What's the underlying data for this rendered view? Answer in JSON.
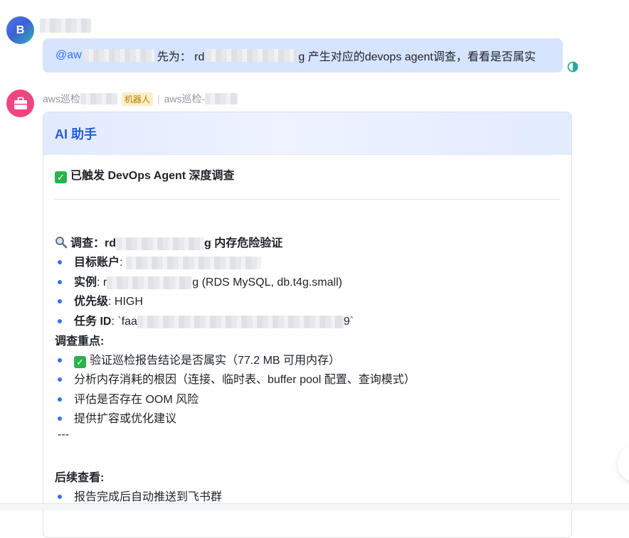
{
  "user": {
    "avatar_letter": "B",
    "message_mention": "@aw",
    "message_middle": "先为： rd",
    "message_tail": "g 产生对应的devops agent调查，看看是否属实"
  },
  "bot": {
    "name_prefix": "aws巡检",
    "badge": "机器人",
    "separator": "|",
    "group_prefix": "aws巡检-",
    "card": {
      "title": "AI 助手",
      "triggered": "已触发 DevOps Agent 深度调查",
      "investigation_label": "调查：",
      "investigation_prefix": "rd",
      "investigation_suffix": "g 内存危险验证",
      "fields": [
        {
          "label": "目标账户",
          "sep": ":",
          "value": ""
        },
        {
          "label": "实例",
          "sep": ": ",
          "value_prefix": "r",
          "value_suffix": "g (RDS MySQL, db.t4g.small)"
        },
        {
          "label": "优先级",
          "sep": ": ",
          "value": "HIGH"
        },
        {
          "label": "任务 ID",
          "sep": ": `",
          "value_prefix": "faa",
          "value_suffix": "9`"
        }
      ],
      "focus_title": "调查重点:",
      "focus_items": [
        "验证巡检报告结论是否属实（77.2 MB 可用内存）",
        "分析内存消耗的根因（连接、临时表、buffer pool 配置、查询模式）",
        "评估是否存在 OOM 风险",
        "提供扩容或优化建议"
      ],
      "hr_text": "---",
      "follow_title": "后续查看:",
      "follow_items": [
        "报告完成后自动推送到飞书群"
      ]
    }
  },
  "icons": {
    "read_status": "read-status-icon",
    "bot_avatar": "briefcase-icon",
    "check": "check-mark-icon",
    "search": "magnifier-icon"
  },
  "colors": {
    "accent": "#3370ff",
    "bubble": "#d6e4fd",
    "bot_avatar": "#f0457e",
    "check": "#2bb24c"
  }
}
